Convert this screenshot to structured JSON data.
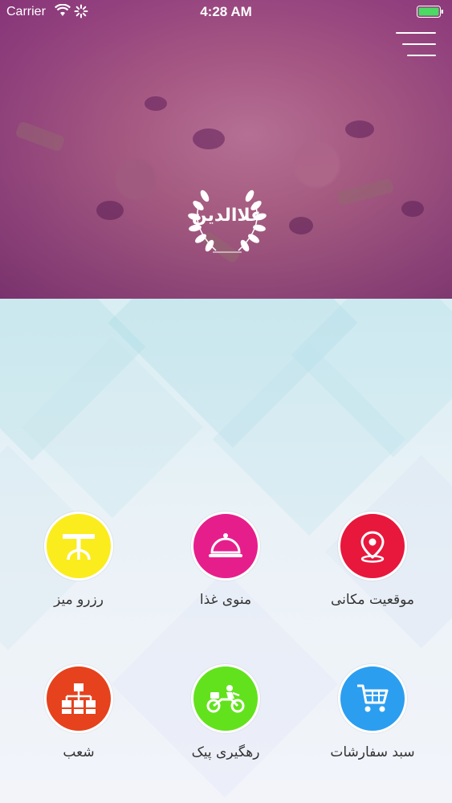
{
  "status_bar": {
    "carrier": "Carrier",
    "time": "4:28 AM"
  },
  "header": {
    "menu_icon": "hamburger-icon",
    "logo_text": "علاالدین"
  },
  "colors": {
    "hero_tint": "#96288c",
    "tile_location": "#e8173c",
    "tile_menu": "#e61e8c",
    "tile_reserve": "#fbec1e",
    "tile_cart": "#2b9ef0",
    "tile_tracking": "#62e21c",
    "tile_branches": "#e5421d"
  },
  "tiles": [
    {
      "label": "موقعیت مکانی",
      "icon": "location-pin-icon"
    },
    {
      "label": "منوی غذا",
      "icon": "food-cloche-icon"
    },
    {
      "label": "رزرو میز",
      "icon": "table-icon"
    },
    {
      "label": "سبد سفارشات",
      "icon": "shopping-cart-icon"
    },
    {
      "label": "رهگیری پیک",
      "icon": "delivery-motorbike-icon"
    },
    {
      "label": "شعب",
      "icon": "branches-sitemap-icon"
    }
  ]
}
